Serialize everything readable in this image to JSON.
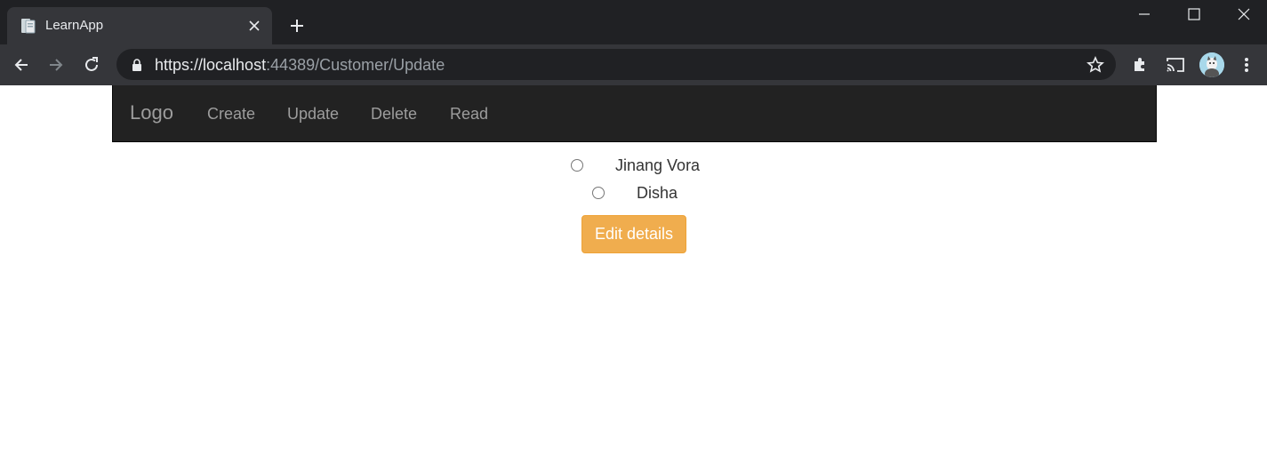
{
  "browser": {
    "tab": {
      "title": "LearnApp"
    },
    "address_bar": {
      "scheme": "https://",
      "host": "localhost",
      "rest": ":44389/Customer/Update"
    }
  },
  "navbar": {
    "brand": "Logo",
    "links": [
      "Create",
      "Update",
      "Delete",
      "Read"
    ]
  },
  "customers": {
    "options": [
      "Jinang Vora",
      "Disha"
    ]
  },
  "form": {
    "submit_label": "Edit details"
  },
  "colors": {
    "navbar_bg": "#222222",
    "nav_link": "#9d9d9d",
    "warning_button": "#f0ad4e",
    "chrome_dark": "#202124",
    "chrome_toolbar": "#35363a"
  },
  "icons": [
    "favicon-icon",
    "close-icon",
    "plus-icon",
    "minimize-icon",
    "maximize-icon",
    "window-close-icon",
    "back-arrow-icon",
    "forward-arrow-icon",
    "reload-icon",
    "lock-icon",
    "star-icon",
    "extensions-icon",
    "cast-icon",
    "profile-avatar",
    "menu-kebab-icon"
  ]
}
